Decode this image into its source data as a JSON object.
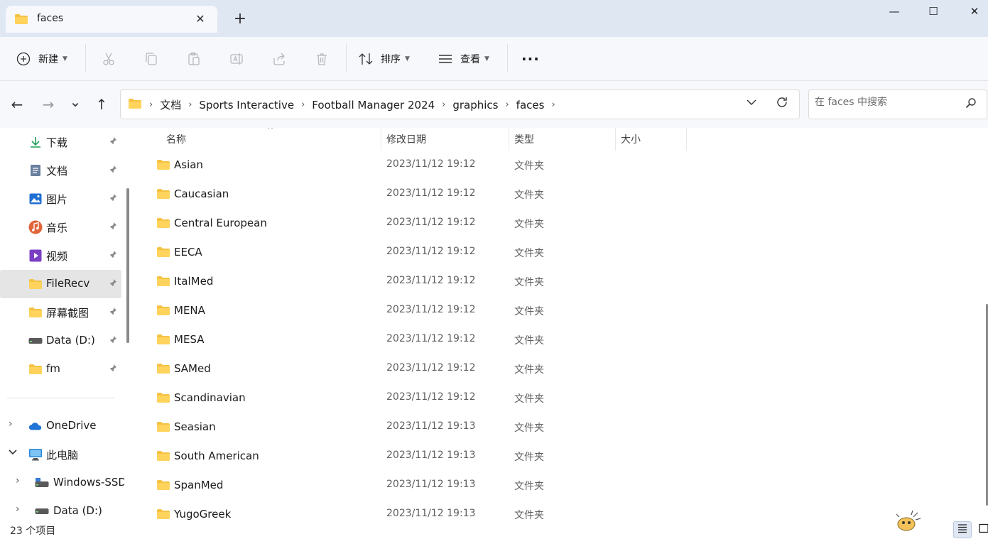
{
  "window": {
    "tab_title": "faces",
    "new_tab_glyph": "+",
    "minimize_glyph": "—",
    "maximize_glyph": "☐",
    "close_glyph": "✕",
    "tab_close_glyph": "✕"
  },
  "toolbar": {
    "new_label": "新建",
    "sort_label": "排序",
    "view_label": "查看",
    "more_glyph": "···",
    "icons": [
      "new-icon",
      "cut-icon",
      "copy-icon",
      "paste-icon",
      "rename-icon",
      "share-icon",
      "delete-icon",
      "sort-icon",
      "view-icon",
      "more-icon"
    ]
  },
  "nav": {
    "back_glyph": "←",
    "forward_glyph": "→",
    "recent_glyph": "⌄",
    "up_glyph": "↑"
  },
  "breadcrumb": {
    "items": [
      "文档",
      "Sports Interactive",
      "Football Manager 2024",
      "graphics",
      "faces"
    ],
    "separator": "›"
  },
  "search": {
    "placeholder": "在 faces 中搜索"
  },
  "sidebar": {
    "quick_access": [
      {
        "label": "下载",
        "icon": "download-icon",
        "pinned": true
      },
      {
        "label": "文档",
        "icon": "document-icon",
        "pinned": true
      },
      {
        "label": "图片",
        "icon": "pictures-icon",
        "pinned": true
      },
      {
        "label": "音乐",
        "icon": "music-icon",
        "pinned": true
      },
      {
        "label": "视频",
        "icon": "video-icon",
        "pinned": true
      },
      {
        "label": "FileRecv",
        "icon": "folder-icon",
        "pinned": true,
        "selected": true
      },
      {
        "label": "屏幕截图",
        "icon": "folder-icon",
        "pinned": true
      },
      {
        "label": "Data (D:)",
        "icon": "drive-icon",
        "pinned": true
      },
      {
        "label": "fm",
        "icon": "folder-icon",
        "pinned": true
      }
    ],
    "tree": [
      {
        "label": "OneDrive",
        "icon": "onedrive-icon",
        "expanded": false
      },
      {
        "label": "此电脑",
        "icon": "pc-icon",
        "expanded": true
      },
      {
        "label": "Windows-SSD",
        "icon": "drive-icon",
        "expanded": false
      },
      {
        "label": "Data (D:)",
        "icon": "drive-icon",
        "expanded": false
      }
    ],
    "pin_glyph": "📌",
    "chev_right": "›",
    "chev_down": "⌄"
  },
  "columns": {
    "name": "名称",
    "modified": "修改日期",
    "type": "类型",
    "size": "大小",
    "sort_glyph": "^"
  },
  "files": [
    {
      "name": "Asian",
      "modified": "2023/11/12 19:12",
      "type": "文件夹"
    },
    {
      "name": "Caucasian",
      "modified": "2023/11/12 19:12",
      "type": "文件夹"
    },
    {
      "name": "Central European",
      "modified": "2023/11/12 19:12",
      "type": "文件夹"
    },
    {
      "name": "EECA",
      "modified": "2023/11/12 19:12",
      "type": "文件夹"
    },
    {
      "name": "ItalMed",
      "modified": "2023/11/12 19:12",
      "type": "文件夹"
    },
    {
      "name": "MENA",
      "modified": "2023/11/12 19:12",
      "type": "文件夹"
    },
    {
      "name": "MESA",
      "modified": "2023/11/12 19:12",
      "type": "文件夹"
    },
    {
      "name": "SAMed",
      "modified": "2023/11/12 19:12",
      "type": "文件夹"
    },
    {
      "name": "Scandinavian",
      "modified": "2023/11/12 19:12",
      "type": "文件夹"
    },
    {
      "name": "Seasian",
      "modified": "2023/11/12 19:13",
      "type": "文件夹"
    },
    {
      "name": "South American",
      "modified": "2023/11/12 19:13",
      "type": "文件夹"
    },
    {
      "name": "SpanMed",
      "modified": "2023/11/12 19:13",
      "type": "文件夹"
    },
    {
      "name": "YugoGreek",
      "modified": "2023/11/12 19:13",
      "type": "文件夹"
    }
  ],
  "status": {
    "item_count": "23 个项目"
  },
  "colors": {
    "folder": "#f5c242",
    "folder_dark": "#e0a82e",
    "accent": "#005fb8",
    "selection": "#e5e5e5",
    "titlebar": "#dfe7f3"
  }
}
